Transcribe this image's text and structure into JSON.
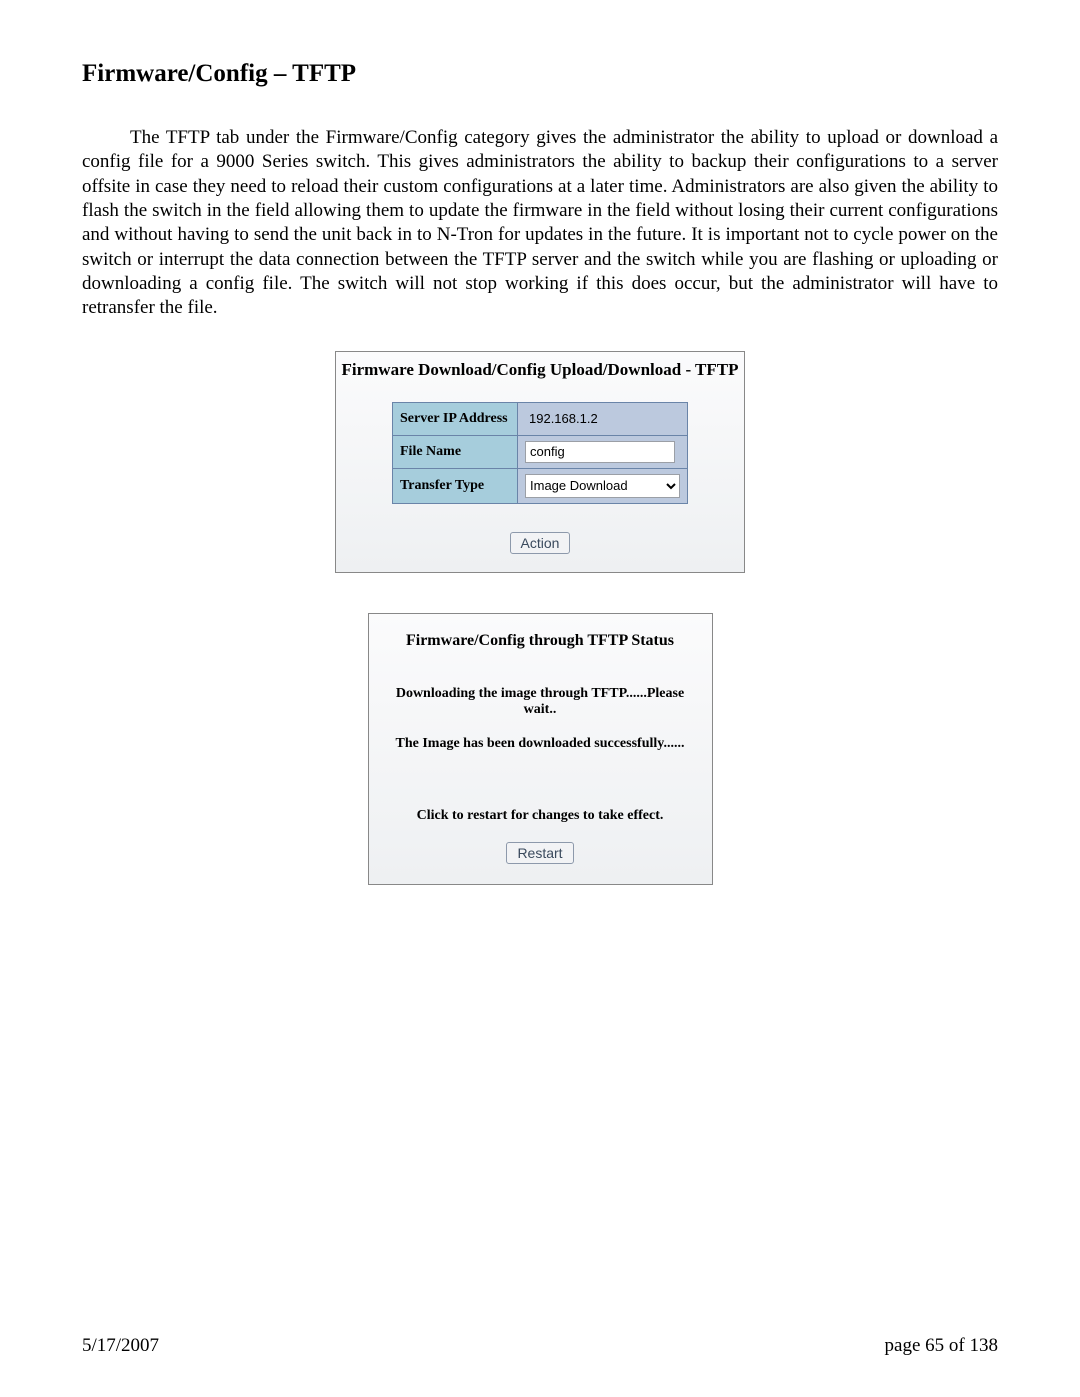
{
  "page": {
    "title": "Firmware/Config – TFTP",
    "body": "The TFTP tab under the Firmware/Config category gives the administrator the ability to upload or download a config file for a 9000 Series switch.  This gives administrators the ability to backup their configurations to a server offsite in case they need to reload their custom configurations at a later time.  Administrators are also given the ability to flash the switch in the field allowing them to update the firmware in the field without losing their current configurations and without having to send the unit back in to N-Tron for updates in the future.  It is important not to cycle power on the switch or interrupt the data connection between the TFTP server and the switch while you are flashing or uploading or downloading a config file.  The switch will not stop working if this does occur, but the administrator will have to retransfer the file."
  },
  "panel1": {
    "title": "Firmware Download/Config Upload/Download - TFTP",
    "fields": {
      "server_ip_label": "Server IP Address",
      "server_ip_value": "192.168.1.2",
      "file_name_label": "File Name",
      "file_name_value": "config",
      "transfer_type_label": "Transfer Type",
      "transfer_type_value": "Image Download"
    },
    "action_button": "Action"
  },
  "panel2": {
    "title": "Firmware/Config through TFTP Status",
    "status1": "Downloading the image through TFTP......Please wait..",
    "status2": "The Image has been downloaded successfully......",
    "restart_text": "Click to restart for changes to take effect.",
    "restart_button": "Restart"
  },
  "footer": {
    "date": "5/17/2007",
    "page_info": "page 65 of 138"
  }
}
